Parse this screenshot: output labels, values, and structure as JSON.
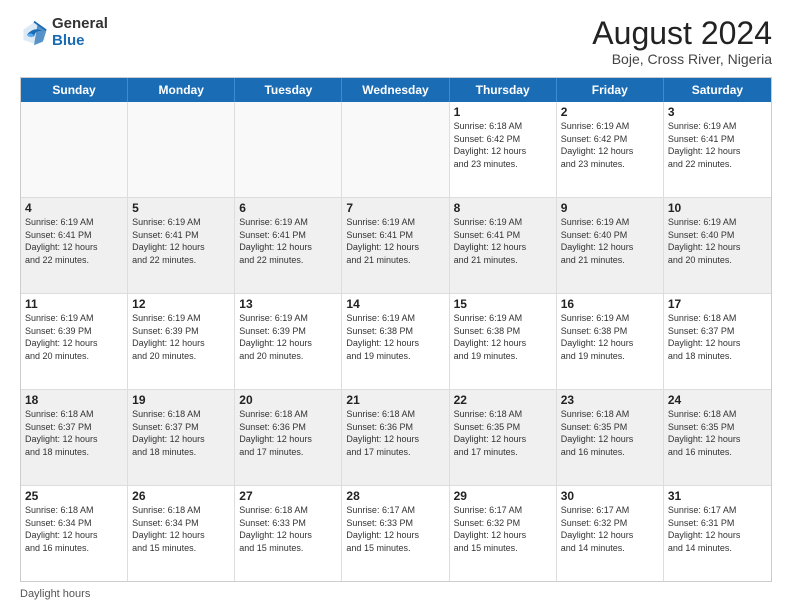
{
  "logo": {
    "general": "General",
    "blue": "Blue"
  },
  "title": "August 2024",
  "subtitle": "Boje, Cross River, Nigeria",
  "weekdays": [
    "Sunday",
    "Monday",
    "Tuesday",
    "Wednesday",
    "Thursday",
    "Friday",
    "Saturday"
  ],
  "footer": "Daylight hours",
  "weeks": [
    [
      {
        "day": "",
        "info": "",
        "empty": true
      },
      {
        "day": "",
        "info": "",
        "empty": true
      },
      {
        "day": "",
        "info": "",
        "empty": true
      },
      {
        "day": "",
        "info": "",
        "empty": true
      },
      {
        "day": "1",
        "info": "Sunrise: 6:18 AM\nSunset: 6:42 PM\nDaylight: 12 hours\nand 23 minutes."
      },
      {
        "day": "2",
        "info": "Sunrise: 6:19 AM\nSunset: 6:42 PM\nDaylight: 12 hours\nand 23 minutes."
      },
      {
        "day": "3",
        "info": "Sunrise: 6:19 AM\nSunset: 6:41 PM\nDaylight: 12 hours\nand 22 minutes."
      }
    ],
    [
      {
        "day": "4",
        "info": "Sunrise: 6:19 AM\nSunset: 6:41 PM\nDaylight: 12 hours\nand 22 minutes."
      },
      {
        "day": "5",
        "info": "Sunrise: 6:19 AM\nSunset: 6:41 PM\nDaylight: 12 hours\nand 22 minutes."
      },
      {
        "day": "6",
        "info": "Sunrise: 6:19 AM\nSunset: 6:41 PM\nDaylight: 12 hours\nand 22 minutes."
      },
      {
        "day": "7",
        "info": "Sunrise: 6:19 AM\nSunset: 6:41 PM\nDaylight: 12 hours\nand 21 minutes."
      },
      {
        "day": "8",
        "info": "Sunrise: 6:19 AM\nSunset: 6:41 PM\nDaylight: 12 hours\nand 21 minutes."
      },
      {
        "day": "9",
        "info": "Sunrise: 6:19 AM\nSunset: 6:40 PM\nDaylight: 12 hours\nand 21 minutes."
      },
      {
        "day": "10",
        "info": "Sunrise: 6:19 AM\nSunset: 6:40 PM\nDaylight: 12 hours\nand 20 minutes."
      }
    ],
    [
      {
        "day": "11",
        "info": "Sunrise: 6:19 AM\nSunset: 6:39 PM\nDaylight: 12 hours\nand 20 minutes."
      },
      {
        "day": "12",
        "info": "Sunrise: 6:19 AM\nSunset: 6:39 PM\nDaylight: 12 hours\nand 20 minutes."
      },
      {
        "day": "13",
        "info": "Sunrise: 6:19 AM\nSunset: 6:39 PM\nDaylight: 12 hours\nand 20 minutes."
      },
      {
        "day": "14",
        "info": "Sunrise: 6:19 AM\nSunset: 6:38 PM\nDaylight: 12 hours\nand 19 minutes."
      },
      {
        "day": "15",
        "info": "Sunrise: 6:19 AM\nSunset: 6:38 PM\nDaylight: 12 hours\nand 19 minutes."
      },
      {
        "day": "16",
        "info": "Sunrise: 6:19 AM\nSunset: 6:38 PM\nDaylight: 12 hours\nand 19 minutes."
      },
      {
        "day": "17",
        "info": "Sunrise: 6:18 AM\nSunset: 6:37 PM\nDaylight: 12 hours\nand 18 minutes."
      }
    ],
    [
      {
        "day": "18",
        "info": "Sunrise: 6:18 AM\nSunset: 6:37 PM\nDaylight: 12 hours\nand 18 minutes."
      },
      {
        "day": "19",
        "info": "Sunrise: 6:18 AM\nSunset: 6:37 PM\nDaylight: 12 hours\nand 18 minutes."
      },
      {
        "day": "20",
        "info": "Sunrise: 6:18 AM\nSunset: 6:36 PM\nDaylight: 12 hours\nand 17 minutes."
      },
      {
        "day": "21",
        "info": "Sunrise: 6:18 AM\nSunset: 6:36 PM\nDaylight: 12 hours\nand 17 minutes."
      },
      {
        "day": "22",
        "info": "Sunrise: 6:18 AM\nSunset: 6:35 PM\nDaylight: 12 hours\nand 17 minutes."
      },
      {
        "day": "23",
        "info": "Sunrise: 6:18 AM\nSunset: 6:35 PM\nDaylight: 12 hours\nand 16 minutes."
      },
      {
        "day": "24",
        "info": "Sunrise: 6:18 AM\nSunset: 6:35 PM\nDaylight: 12 hours\nand 16 minutes."
      }
    ],
    [
      {
        "day": "25",
        "info": "Sunrise: 6:18 AM\nSunset: 6:34 PM\nDaylight: 12 hours\nand 16 minutes."
      },
      {
        "day": "26",
        "info": "Sunrise: 6:18 AM\nSunset: 6:34 PM\nDaylight: 12 hours\nand 15 minutes."
      },
      {
        "day": "27",
        "info": "Sunrise: 6:18 AM\nSunset: 6:33 PM\nDaylight: 12 hours\nand 15 minutes."
      },
      {
        "day": "28",
        "info": "Sunrise: 6:17 AM\nSunset: 6:33 PM\nDaylight: 12 hours\nand 15 minutes."
      },
      {
        "day": "29",
        "info": "Sunrise: 6:17 AM\nSunset: 6:32 PM\nDaylight: 12 hours\nand 15 minutes."
      },
      {
        "day": "30",
        "info": "Sunrise: 6:17 AM\nSunset: 6:32 PM\nDaylight: 12 hours\nand 14 minutes."
      },
      {
        "day": "31",
        "info": "Sunrise: 6:17 AM\nSunset: 6:31 PM\nDaylight: 12 hours\nand 14 minutes."
      }
    ]
  ]
}
